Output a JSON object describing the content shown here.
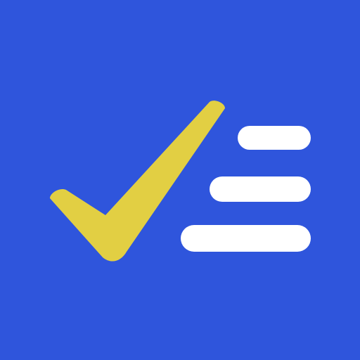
{
  "app_icon": {
    "icon_name": "checklist-icon",
    "colors": {
      "background": "#2F55DC",
      "checkmark": "#E2CF43",
      "lines": "#FFFFFF"
    },
    "checkmark_icon": "checkmark-icon",
    "list_line_count": 3
  }
}
